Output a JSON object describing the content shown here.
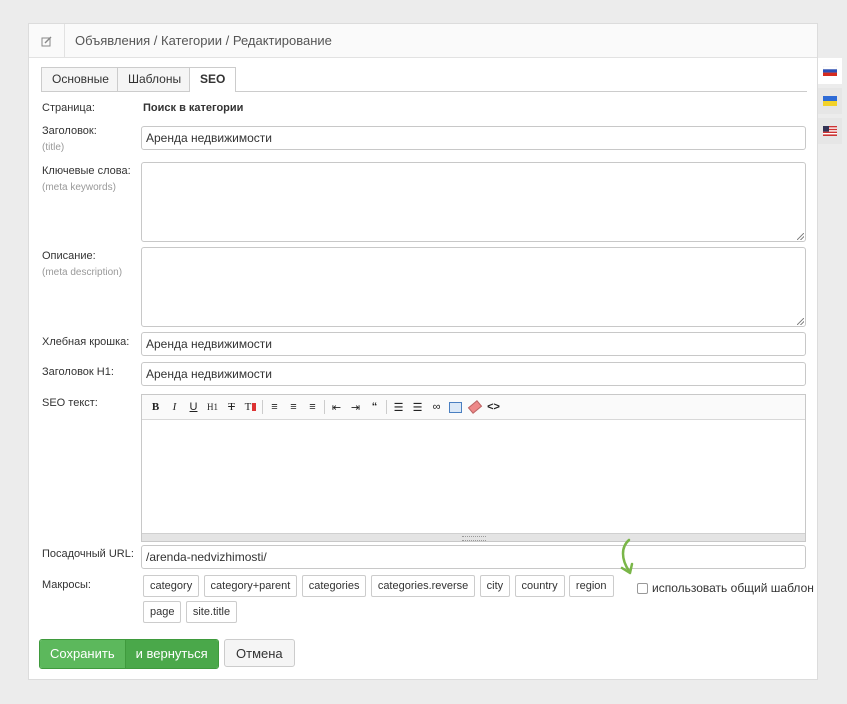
{
  "header": {
    "breadcrumb": "Объявления / Категории / Редактирование"
  },
  "tabs": [
    {
      "label": "Основные"
    },
    {
      "label": "Шаблоны"
    },
    {
      "label": "SEO"
    }
  ],
  "fields": {
    "page_label": "Страница:",
    "page_value": "Поиск в категории",
    "title_label": "Заголовок:",
    "title_hint": "(title)",
    "title_value": "Аренда недвижимости",
    "keywords_label": "Ключевые слова:",
    "keywords_hint": "(meta keywords)",
    "description_label": "Описание:",
    "description_hint": "(meta description)",
    "breadcrumb_label": "Хлебная крошка:",
    "breadcrumb_value": "Аренда недвижимости",
    "h1_label": "Заголовок H1:",
    "h1_value": "Аренда недвижимости",
    "seo_text_label": "SEO текст:",
    "url_label": "Посадочный URL:",
    "url_value": "/arenda-nedvizhimosti/",
    "macros_label": "Макросы:"
  },
  "macros": [
    "category",
    "category+parent",
    "categories",
    "categories.reverse",
    "city",
    "country",
    "region",
    "page",
    "site.title"
  ],
  "common_template_label": "использовать общий шаблон",
  "buttons": {
    "save": "Сохранить",
    "save_return": "и вернуться",
    "cancel": "Отмена"
  },
  "toolbar_icons": [
    "bold-icon",
    "italic-icon",
    "underline-icon",
    "heading-icon",
    "strikethrough-icon",
    "text-color-icon",
    "align-left-icon",
    "align-center-icon",
    "align-right-icon",
    "outdent-icon",
    "indent-icon",
    "quote-icon",
    "ordered-list-icon",
    "unordered-list-icon",
    "link-icon",
    "fullscreen-icon",
    "eraser-icon",
    "source-code-icon"
  ],
  "colors": {
    "save_green": "#5cb85c",
    "arrow_green": "#7ab648"
  },
  "languages": [
    "ru-flag-icon",
    "ua-flag-icon",
    "us-flag-icon"
  ]
}
